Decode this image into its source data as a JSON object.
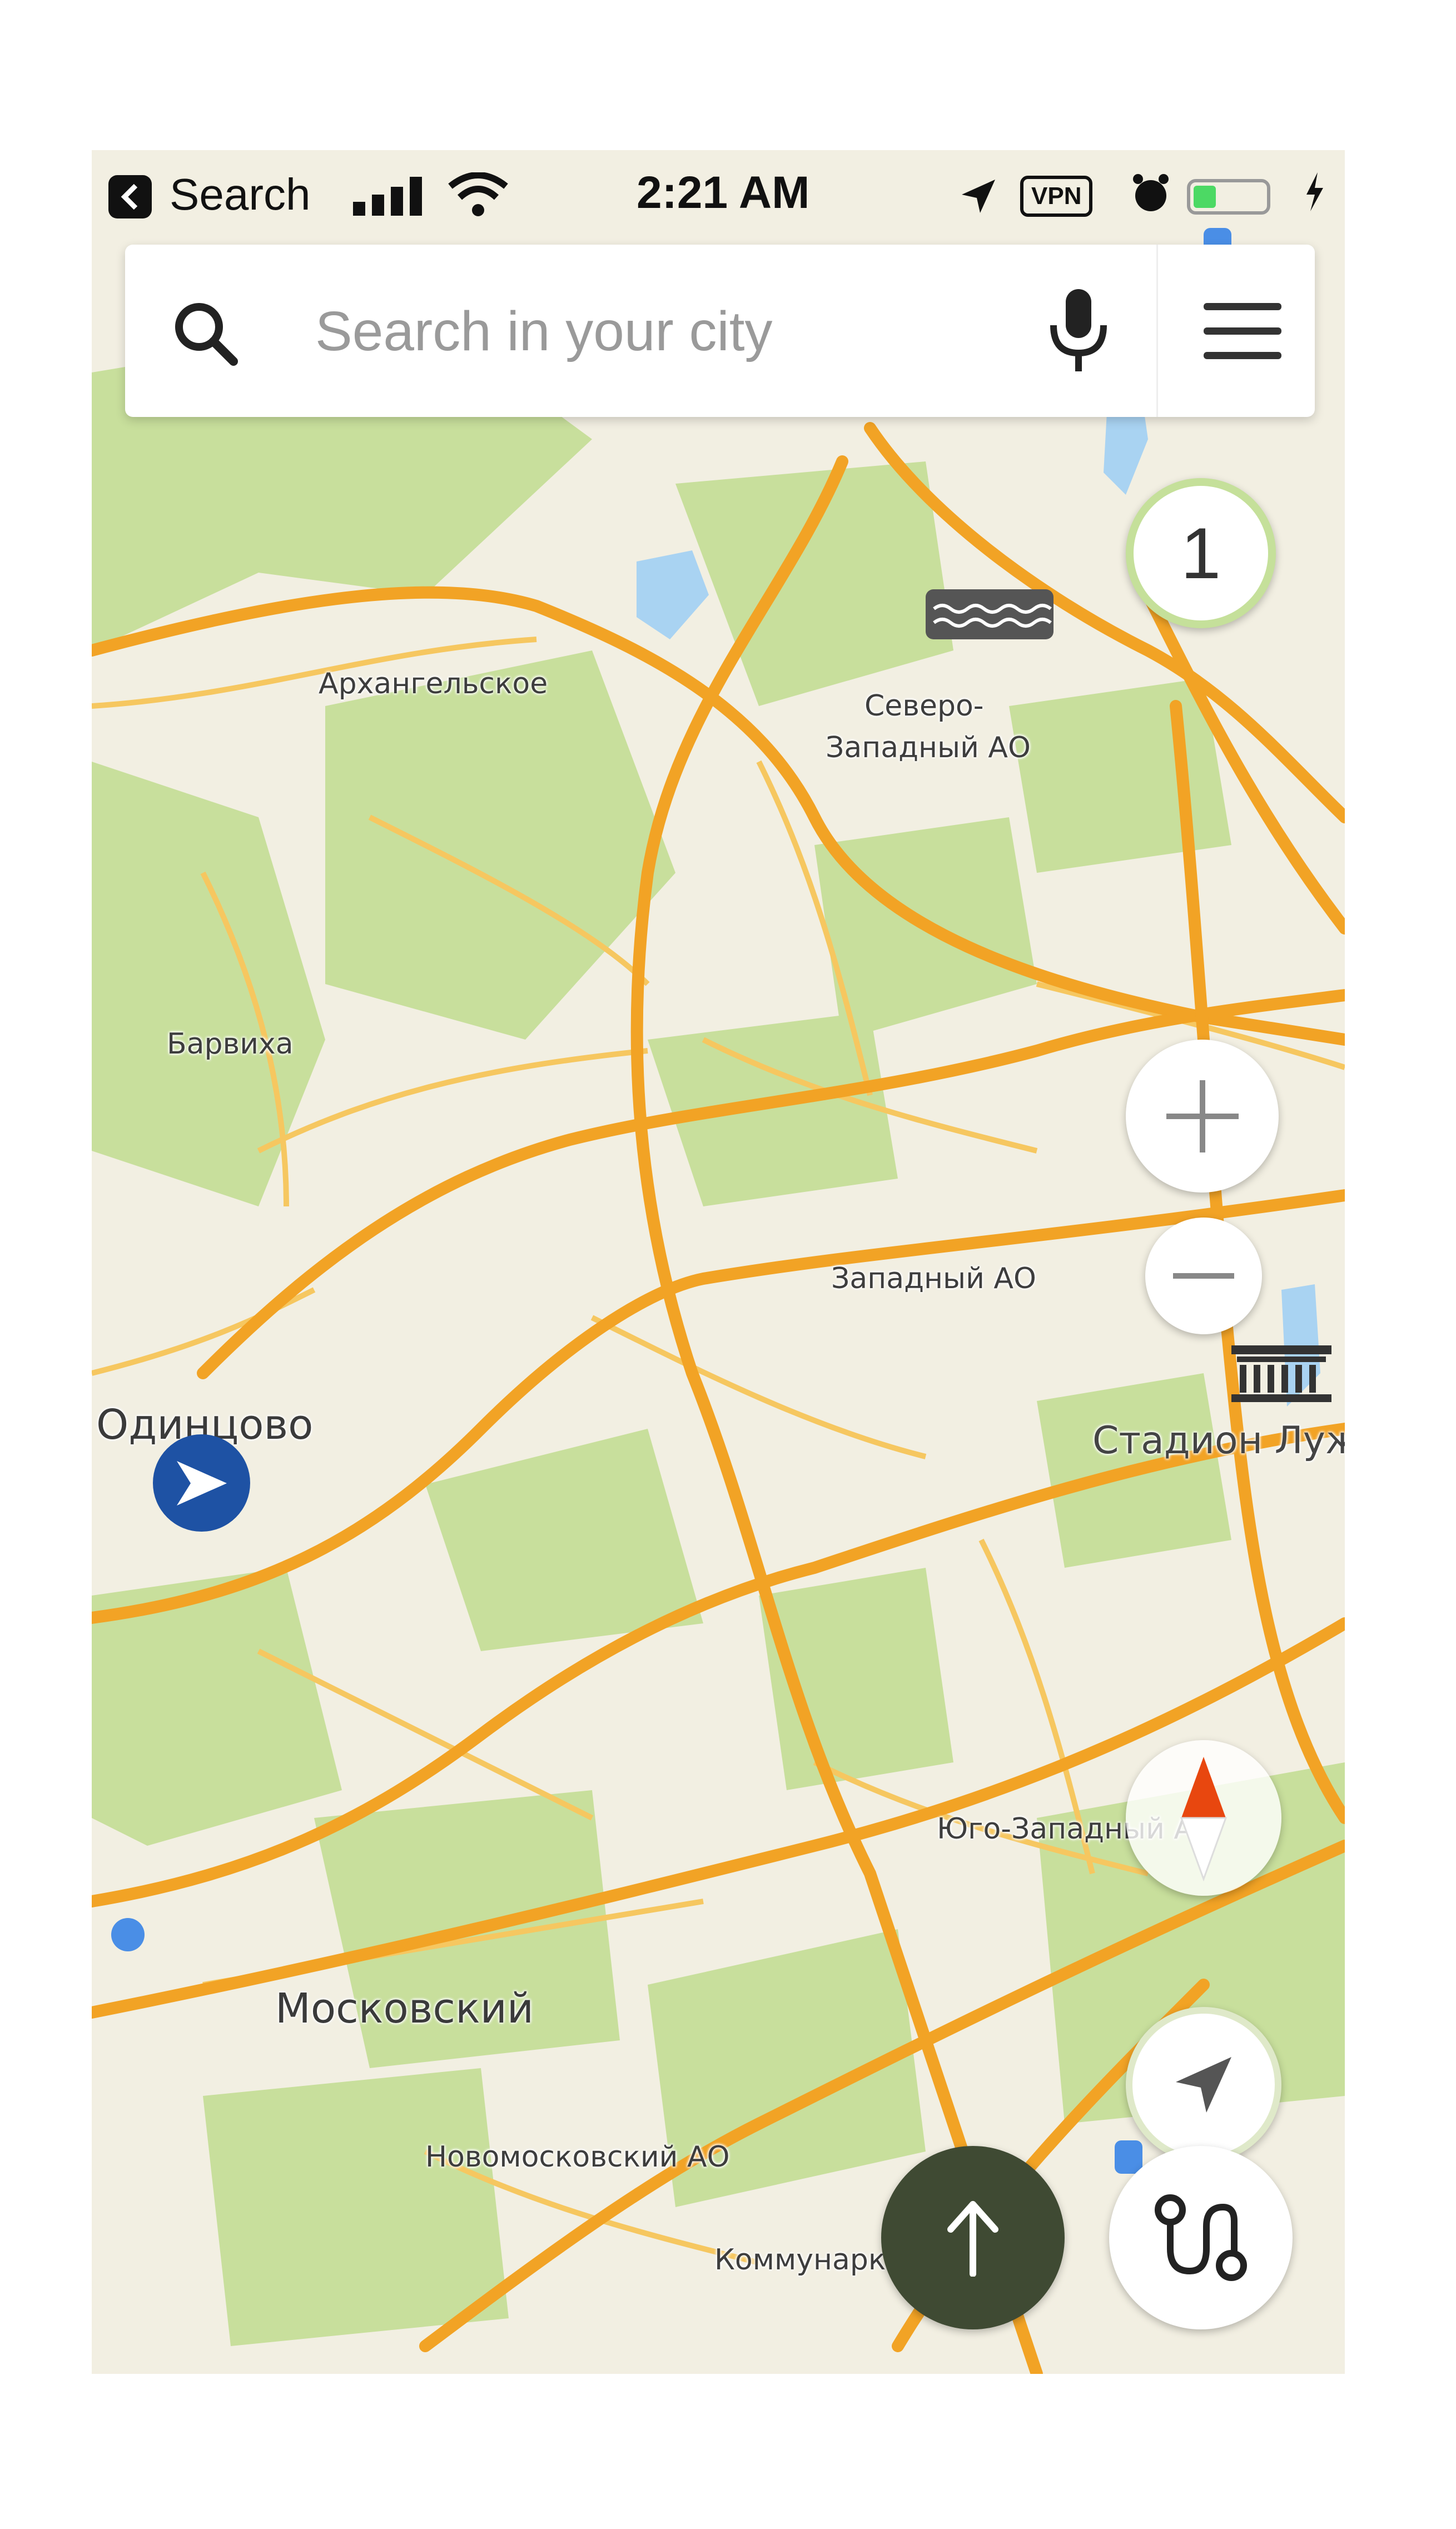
{
  "status_bar": {
    "back_label": "Search",
    "time": "2:21 AM",
    "vpn": "VPN"
  },
  "search": {
    "placeholder": "Search in your city"
  },
  "controls": {
    "traffic_level": "1"
  },
  "map": {
    "labels": {
      "arkhangelskoe": "Архангельское",
      "severo": "Северо-",
      "zapadny_ao_nw": "Западный АО",
      "barvikha": "Барвиха",
      "zapadny_ao": "Западный АО",
      "odintsovo": "Одинцово",
      "stadion": "Стадион Лужники",
      "yugo": "Юго-Западный АО",
      "moskovsky": "Московский",
      "novomoskovsky": "Новомосковский АО",
      "kommunarka": "Коммунарка"
    }
  },
  "colors": {
    "road": "#f2a325",
    "park": "#c8df9c",
    "background": "#f2efe2",
    "water": "#a9d3f2",
    "user_marker": "#1e52a4",
    "go_button": "#3f4a33"
  }
}
